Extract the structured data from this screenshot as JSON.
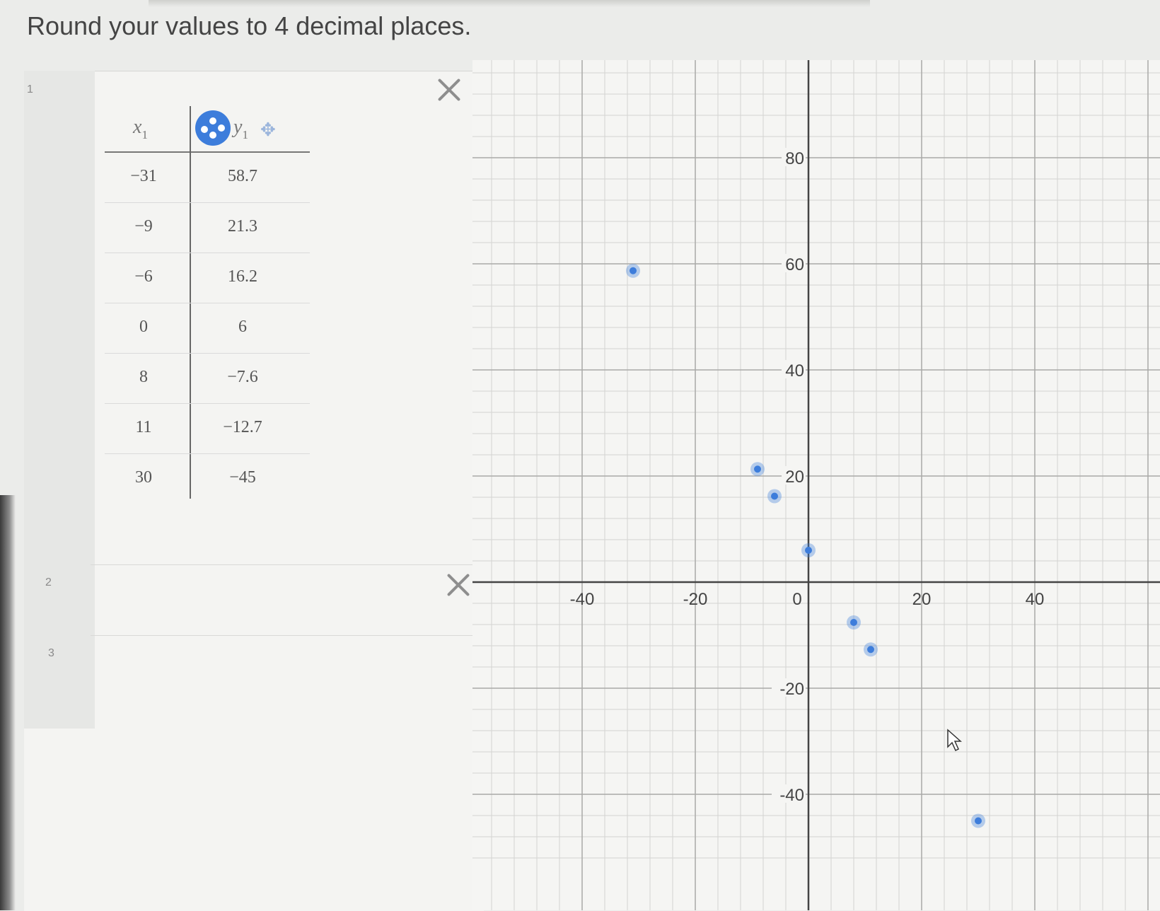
{
  "instruction": "Round your values to 4 decimal places.",
  "expressions": {
    "rows": [
      {
        "number": "1"
      },
      {
        "number": "2"
      },
      {
        "number": "3"
      }
    ]
  },
  "table": {
    "x_header": "x",
    "x_sub": "1",
    "y_header": "y",
    "y_sub": "1",
    "move_glyph": "✥",
    "rows": [
      {
        "x": "−31",
        "y": "58.7"
      },
      {
        "x": "−9",
        "y": "21.3"
      },
      {
        "x": "−6",
        "y": "16.2"
      },
      {
        "x": "0",
        "y": "6"
      },
      {
        "x": "8",
        "y": "−7.6"
      },
      {
        "x": "11",
        "y": "−12.7"
      },
      {
        "x": "30",
        "y": "−45"
      }
    ]
  },
  "chart_data": {
    "type": "scatter",
    "x": [
      -31,
      -9,
      -6,
      0,
      8,
      11,
      30
    ],
    "y": [
      58.7,
      21.3,
      16.2,
      6,
      -7.6,
      -12.7,
      -45
    ],
    "xlim": [
      -60,
      60
    ],
    "ylim": [
      -55,
      96
    ],
    "x_ticks": [
      "-40",
      "-20",
      "0",
      "20",
      "40"
    ],
    "y_ticks": [
      "80",
      "60",
      "40",
      "20",
      "-20",
      "-40"
    ],
    "grid": true,
    "point_color": "#3d7ddb"
  }
}
